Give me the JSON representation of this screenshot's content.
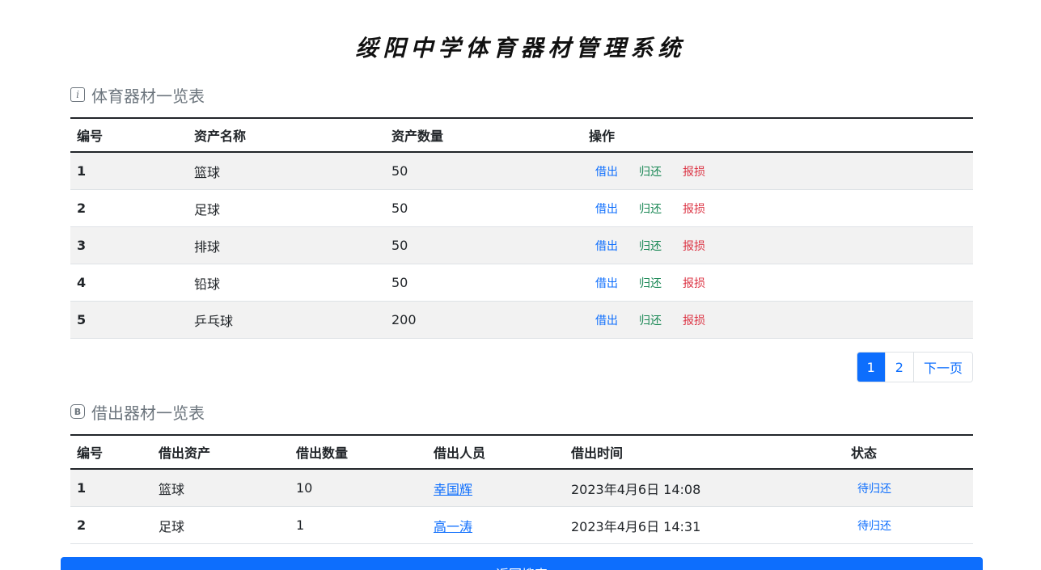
{
  "app": {
    "title": "绥阳中学体育器材管理系统"
  },
  "equipment_section": {
    "icon": "info-icon",
    "icon_glyph": "i",
    "heading": "体育器材一览表",
    "columns": [
      "编号",
      "资产名称",
      "资产数量",
      "操作"
    ],
    "rows": [
      {
        "id": "1",
        "name": "篮球",
        "qty": "50"
      },
      {
        "id": "2",
        "name": "足球",
        "qty": "50"
      },
      {
        "id": "3",
        "name": "排球",
        "qty": "50"
      },
      {
        "id": "4",
        "name": "铅球",
        "qty": "50"
      },
      {
        "id": "5",
        "name": "乒乓球",
        "qty": "200"
      }
    ],
    "actions": {
      "borrow": "借出",
      "return": "归还",
      "damage": "报损"
    }
  },
  "pagination": {
    "pages": [
      "1",
      "2"
    ],
    "active": "1",
    "next": "下一页"
  },
  "borrow_section": {
    "icon": "b-badge-icon",
    "icon_glyph": "B",
    "heading": "借出器材一览表",
    "columns": [
      "编号",
      "借出资产",
      "借出数量",
      "借出人员",
      "借出时间",
      "状态"
    ],
    "rows": [
      {
        "id": "1",
        "asset": "篮球",
        "qty": "10",
        "person": "幸国辉",
        "time": "2023年4月6日 14:08",
        "status": "待归还"
      },
      {
        "id": "2",
        "asset": "足球",
        "qty": "1",
        "person": "高一涛",
        "time": "2023年4月6日 14:31",
        "status": "待归还"
      }
    ]
  },
  "back_button": {
    "label": "返回搜索"
  },
  "colors": {
    "primary": "#0d6efd",
    "success": "#198754",
    "danger": "#dc3545",
    "muted": "#6c757d"
  }
}
